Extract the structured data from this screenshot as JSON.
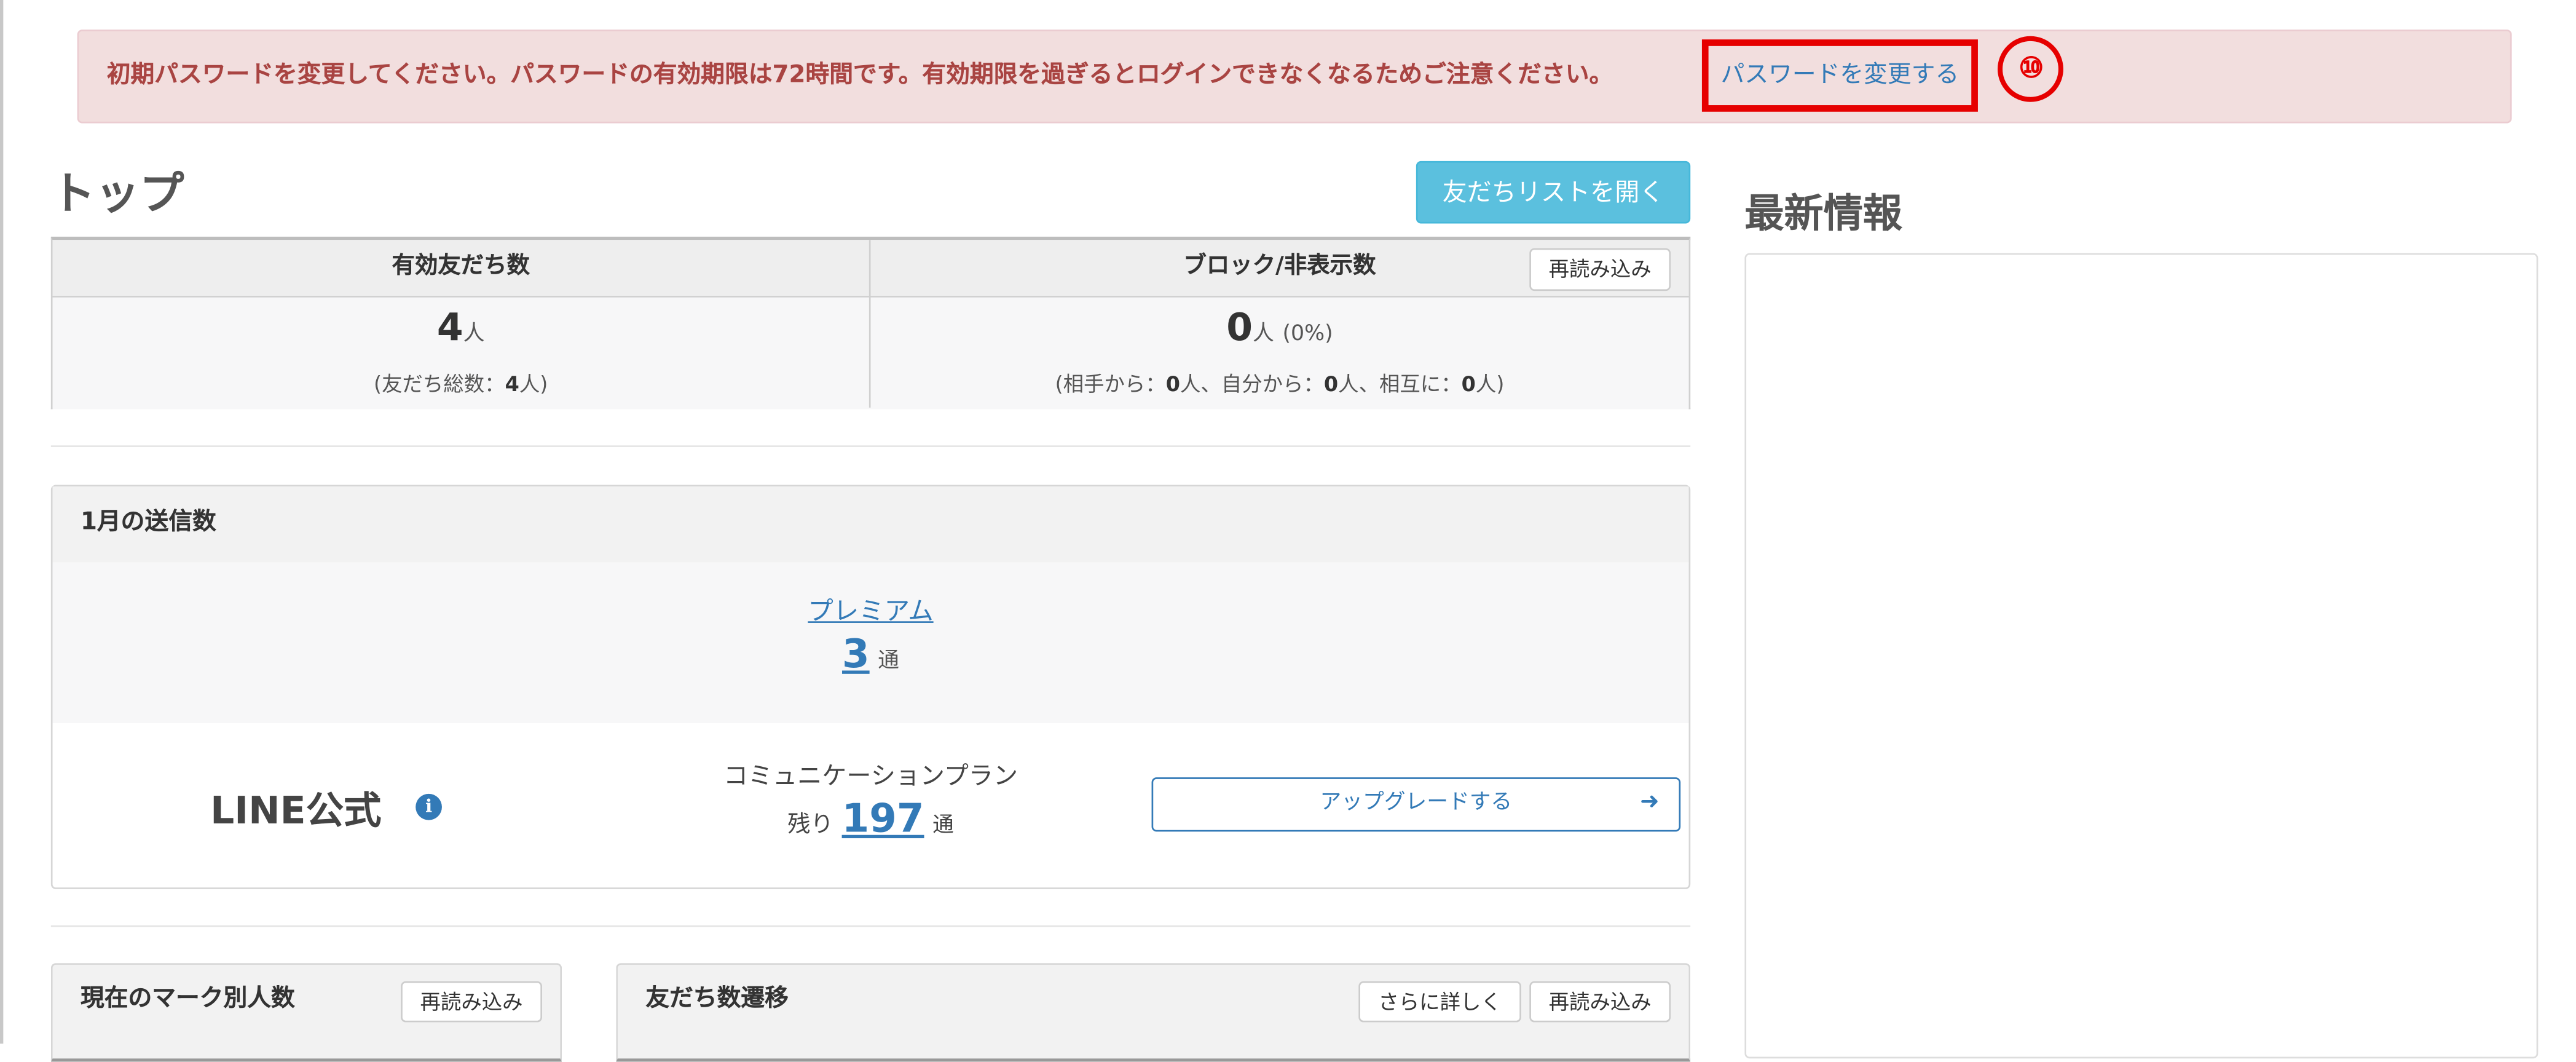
{
  "alert": {
    "message": "初期パスワードを変更してください。パスワードの有効期限は72時間です。有効期限を過ぎるとログインできなくなるためご注意ください。",
    "link_label": "パスワードを変更する",
    "marker": "⑩"
  },
  "page": {
    "title": "トップ",
    "open_friends_list_label": "友だちリストを開く"
  },
  "stats": {
    "active_friends": {
      "header": "有効友だち数",
      "value": "4",
      "unit": "人",
      "note_prefix": "(友だち総数：",
      "note_value": "4",
      "note_suffix": "人)"
    },
    "blocked": {
      "header": "ブロック/非表示数",
      "reload_label": "再読み込み",
      "value": "0",
      "unit": "人",
      "percent": "(0%)",
      "note_open": "(相手から：",
      "from_them": "0",
      "note_mid1": "人、自分から：",
      "from_me": "0",
      "note_mid2": "人、相互に：",
      "mutual": "0",
      "note_close": "人)"
    }
  },
  "monthly": {
    "title": "1月の送信数",
    "premium_label": "プレミアム",
    "premium_value": "3",
    "premium_unit": "通",
    "line_official_label": "LINE公式",
    "plan_name": "コミュニケーションプラン",
    "remaining_label": "残り",
    "remaining_value": "197",
    "remaining_unit": "通",
    "upgrade_label": "アップグレードする"
  },
  "news": {
    "title": "最新情報"
  },
  "bottom": {
    "marks_title": "現在のマーク別人数",
    "marks_reload_label": "再読み込み",
    "trend_title": "友だち数遷移",
    "trend_more_label": "さらに詳しく",
    "trend_reload_label": "再読み込み"
  },
  "colors": {
    "alert_bg": "#f2dede",
    "alert_text": "#a94442",
    "highlight": "#e60000",
    "link": "#337ab7",
    "info_button": "#5bc0de"
  }
}
